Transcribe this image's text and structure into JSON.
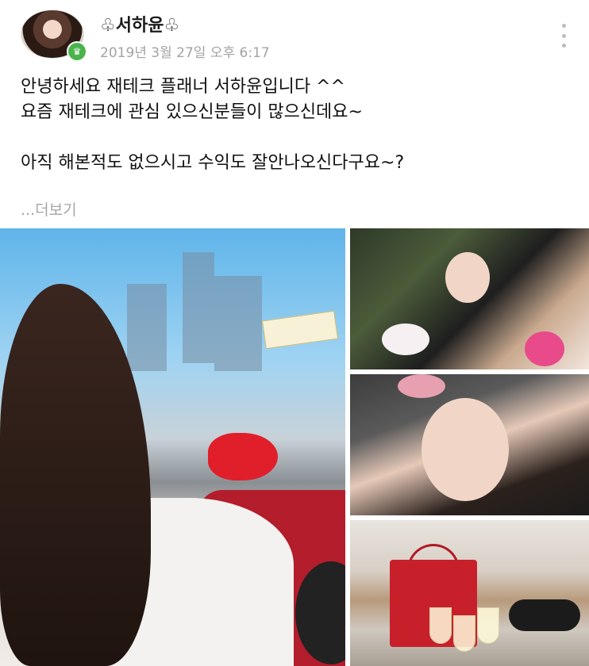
{
  "post": {
    "author_name": "♧서하윤♧",
    "timestamp": "2019년 3월 27일 오후 6:17",
    "badge_icon": "crown-icon",
    "lines": [
      "안녕하세요 재테크 플래너 서하윤입니다 ^^",
      "요즘 재테크에 관심 있으신분들이 많으신데요~",
      "",
      "아직 해본적도 없으시고 수익도 잘안나오신다구요~?"
    ],
    "more_label": "...더보기"
  },
  "colors": {
    "badge": "#4bb34b",
    "secondary_text": "#a3a3a3"
  }
}
